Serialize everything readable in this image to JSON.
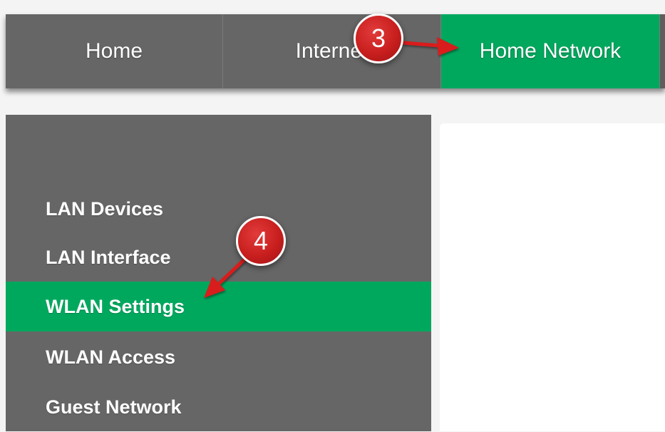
{
  "topnav": {
    "tabs": [
      {
        "label": "Home"
      },
      {
        "label": "Internet"
      },
      {
        "label": "Home Network",
        "active": true
      }
    ]
  },
  "sidebar": {
    "items": [
      {
        "label": "LAN Devices"
      },
      {
        "label": "LAN Interface"
      },
      {
        "label": "WLAN Settings",
        "active": true
      },
      {
        "label": "WLAN Access"
      },
      {
        "label": "Guest Network"
      }
    ]
  },
  "annotations": {
    "step_3": "3",
    "step_4": "4"
  },
  "colors": {
    "nav_background": "#666666",
    "active_green": "#00a85e",
    "annotation_red": "#c81e1e"
  }
}
